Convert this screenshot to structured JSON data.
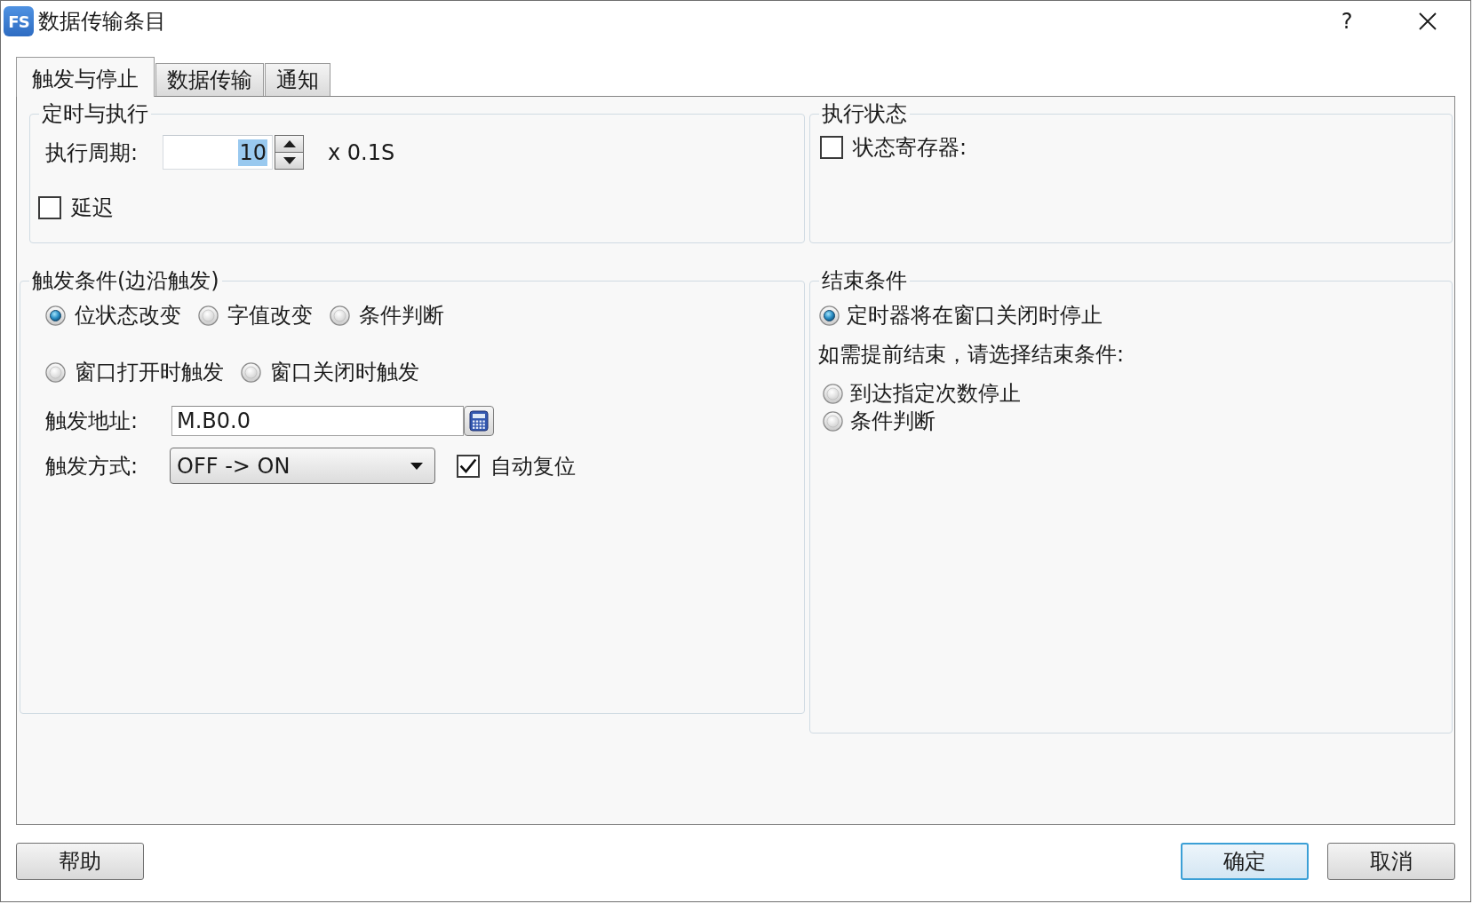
{
  "window": {
    "logo": "FS",
    "title": "数据传输条目",
    "help_button": "?"
  },
  "tabs": [
    {
      "label": "触发与停止",
      "selected": true
    },
    {
      "label": "数据传输",
      "selected": false
    },
    {
      "label": "通知",
      "selected": false
    }
  ],
  "timing": {
    "title": "定时与执行",
    "period": {
      "label": "执行周期:",
      "value": "10",
      "highlighted": true,
      "unit": "x 0.1S"
    },
    "delay": {
      "label": "延迟",
      "checked": false
    }
  },
  "status": {
    "title": "执行状态",
    "register": {
      "label": "状态寄存器:",
      "checked": false
    }
  },
  "trigger": {
    "title": "触发条件(边沿触发)",
    "rows": [
      [
        {
          "label": "位状态改变",
          "selected": true
        },
        {
          "label": "字值改变",
          "selected": false
        },
        {
          "label": "条件判断",
          "selected": false
        }
      ],
      [
        {
          "label": "窗口打开时触发",
          "selected": false
        },
        {
          "label": "窗口关闭时触发",
          "selected": false
        }
      ]
    ],
    "address": {
      "label": "触发地址:",
      "value": "M.B0.0"
    },
    "mode": {
      "label": "触发方式:",
      "value": "OFF -> ON"
    },
    "auto_reset": {
      "label": "自动复位",
      "checked": true
    }
  },
  "end": {
    "title": "结束条件",
    "stop_option": {
      "label": "定时器将在窗口关闭时停止",
      "selected": true
    },
    "hint": "如需提前结束，请选择结束条件:",
    "early_options": [
      {
        "label": "到达指定次数停止",
        "selected": false
      },
      {
        "label": "条件判断",
        "selected": false
      }
    ]
  },
  "footer": {
    "help": {
      "label": "帮助"
    },
    "buttons": [
      {
        "label": "确定",
        "default": true
      },
      {
        "label": "取消",
        "default": false
      }
    ]
  }
}
